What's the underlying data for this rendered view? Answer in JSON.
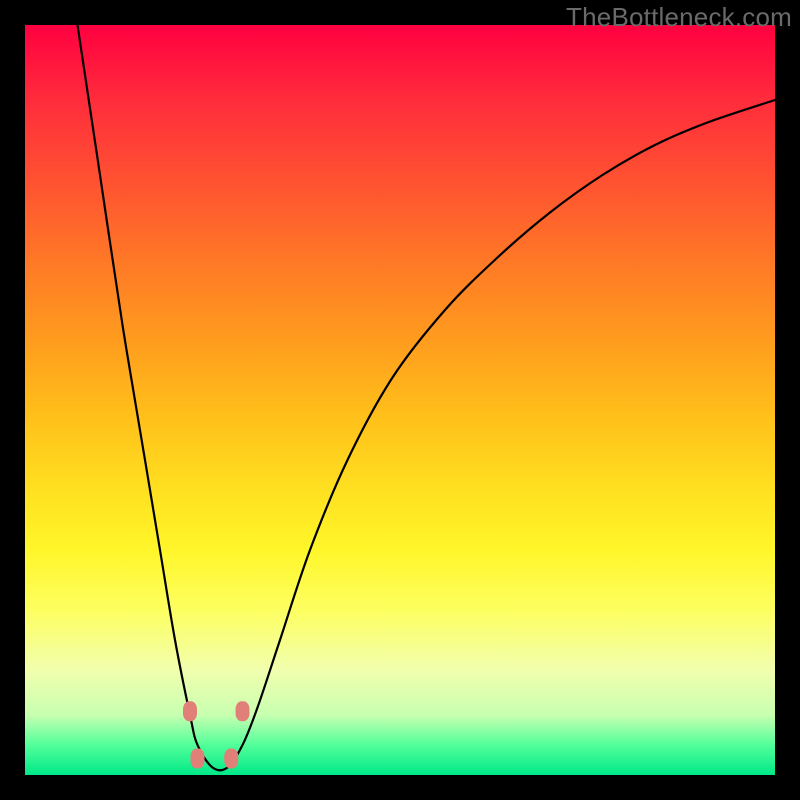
{
  "watermark": "TheBottleneck.com",
  "chart_data": {
    "type": "line",
    "title": "",
    "xlabel": "",
    "ylabel": "",
    "xlim": [
      0,
      100
    ],
    "ylim": [
      0,
      100
    ],
    "grid": false,
    "series": [
      {
        "name": "curve",
        "x": [
          7,
          10,
          13,
          16,
          18,
          20,
          22,
          23,
          25,
          27,
          29,
          31,
          34,
          38,
          43,
          49,
          56,
          63,
          70,
          77,
          84,
          91,
          100
        ],
        "y": [
          100,
          80,
          60,
          42,
          30,
          18,
          8,
          4,
          1,
          1,
          4,
          9,
          18,
          30,
          42,
          53,
          62,
          69,
          75,
          80,
          84,
          87,
          90
        ]
      }
    ],
    "markers": [
      {
        "x": 22.0,
        "y": 8.5
      },
      {
        "x": 23.0,
        "y": 2.2
      },
      {
        "x": 27.5,
        "y": 2.2
      },
      {
        "x": 29.0,
        "y": 8.5
      }
    ],
    "marker_color": "#e08078",
    "curve_color": "#000000"
  }
}
